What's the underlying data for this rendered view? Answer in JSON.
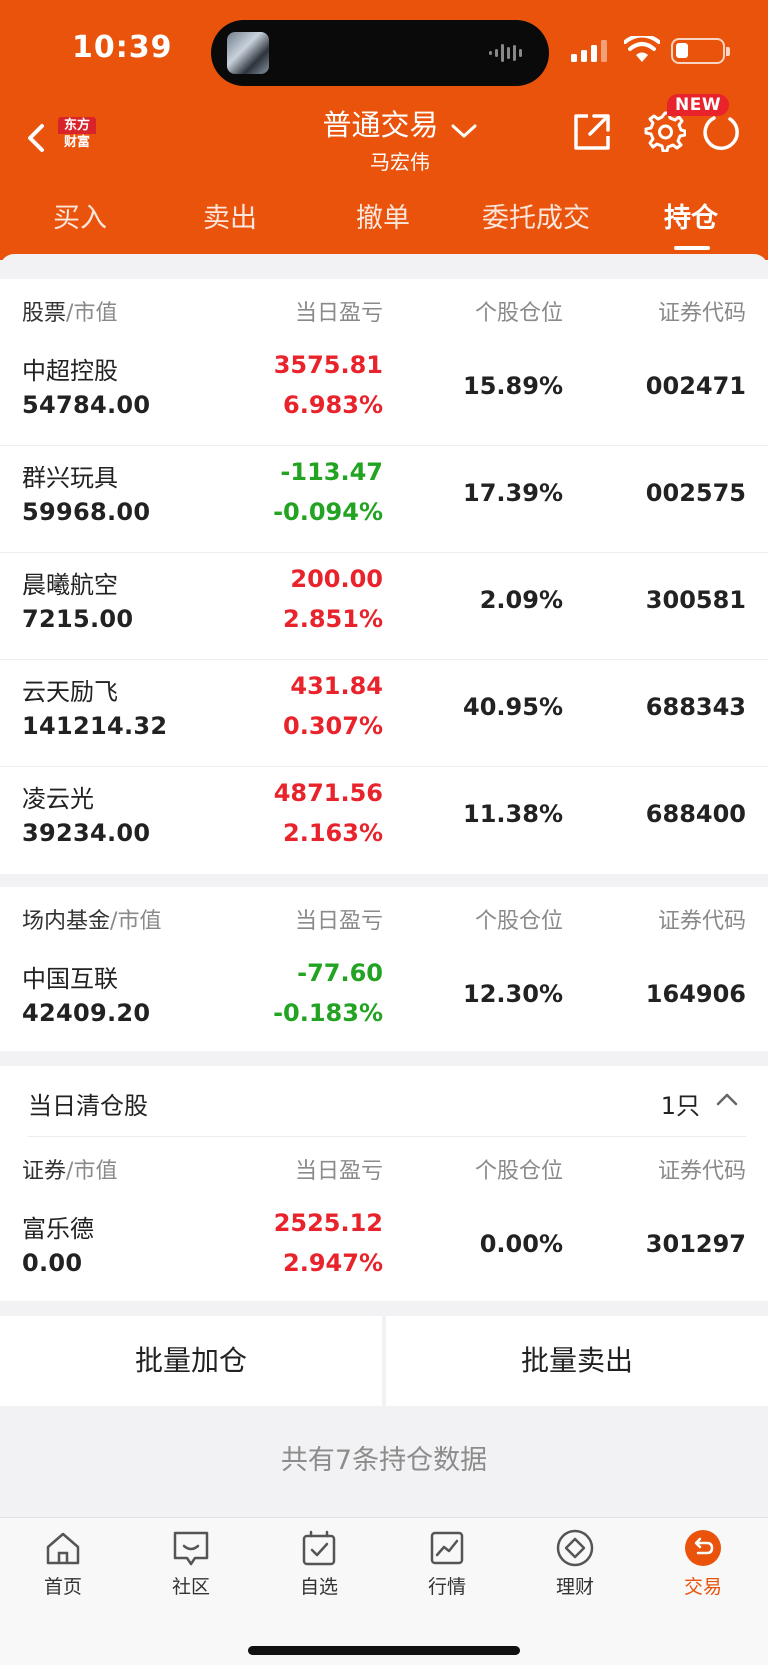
{
  "status_bar": {
    "time": "10:39"
  },
  "header": {
    "logo": {
      "line1": "东方",
      "line2": "财富"
    },
    "title": "普通交易",
    "account_name": "马宏伟",
    "new_badge": "NEW",
    "colors": {
      "brand": "#e9530c",
      "badge": "#e8232b"
    }
  },
  "tabs": [
    {
      "label": "买入"
    },
    {
      "label": "卖出"
    },
    {
      "label": "撤单"
    },
    {
      "label": "委托成交"
    },
    {
      "label": "持仓",
      "active": true
    }
  ],
  "stocks": {
    "header": {
      "name": "股票",
      "sep": "/",
      "mv": "市值",
      "pl": "当日盈亏",
      "position": "个股仓位",
      "code": "证券代码"
    },
    "rows": [
      {
        "name": "中超控股",
        "market_value": "54784.00",
        "pl": "3575.81",
        "pl_pct": "6.983%",
        "trend": "up",
        "position": "15.89%",
        "code": "002471"
      },
      {
        "name": "群兴玩具",
        "market_value": "59968.00",
        "pl": "-113.47",
        "pl_pct": "-0.094%",
        "trend": "down",
        "position": "17.39%",
        "code": "002575"
      },
      {
        "name": "晨曦航空",
        "market_value": "7215.00",
        "pl": "200.00",
        "pl_pct": "2.851%",
        "trend": "up",
        "position": "2.09%",
        "code": "300581"
      },
      {
        "name": "云天励飞",
        "market_value": "141214.32",
        "pl": "431.84",
        "pl_pct": "0.307%",
        "trend": "up",
        "position": "40.95%",
        "code": "688343"
      },
      {
        "name": "凌云光",
        "market_value": "39234.00",
        "pl": "4871.56",
        "pl_pct": "2.163%",
        "trend": "up",
        "position": "11.38%",
        "code": "688400"
      }
    ]
  },
  "funds": {
    "header": {
      "name": "场内基金",
      "sep": "/",
      "mv": "市值",
      "pl": "当日盈亏",
      "position": "个股仓位",
      "code": "证券代码"
    },
    "rows": [
      {
        "name": "中国互联",
        "market_value": "42409.20",
        "pl": "-77.60",
        "pl_pct": "-0.183%",
        "trend": "down",
        "position": "12.30%",
        "code": "164906"
      }
    ]
  },
  "cleared": {
    "title": "当日清仓股",
    "count": "1只",
    "header": {
      "name": "证券",
      "sep": "/",
      "mv": "市值",
      "pl": "当日盈亏",
      "position": "个股仓位",
      "code": "证券代码"
    },
    "rows": [
      {
        "name": "富乐德",
        "market_value": "0.00",
        "pl": "2525.12",
        "pl_pct": "2.947%",
        "trend": "up",
        "position": "0.00%",
        "code": "301297"
      }
    ]
  },
  "actions": {
    "batch_add": "批量加仓",
    "batch_sell": "批量卖出"
  },
  "summary": "共有7条持仓数据",
  "bottom_nav": [
    {
      "label": "首页",
      "icon": "home-icon"
    },
    {
      "label": "社区",
      "icon": "chat-icon"
    },
    {
      "label": "自选",
      "icon": "watchlist-icon"
    },
    {
      "label": "行情",
      "icon": "market-chart-icon"
    },
    {
      "label": "理财",
      "icon": "wealth-diamond-icon"
    },
    {
      "label": "交易",
      "icon": "trade-icon",
      "active": true
    }
  ]
}
